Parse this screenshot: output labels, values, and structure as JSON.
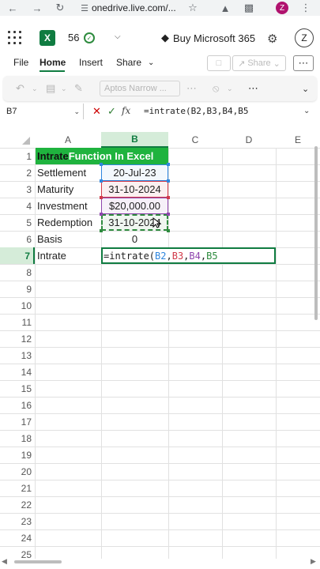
{
  "browser": {
    "url": "onedrive.live.com/...",
    "profile_initial": "Z"
  },
  "app": {
    "file_name": "56",
    "buy_label": "Buy Microsoft 365",
    "avatar_initial": "Z"
  },
  "ribbon": {
    "tabs": [
      "File",
      "Home",
      "Insert",
      "Share"
    ],
    "share_label": "Share"
  },
  "toolbar": {
    "font_name": "Aptos Narrow ..."
  },
  "formula_bar": {
    "name_box": "B7",
    "formula": "=intrate(B2,B3,B4,B5"
  },
  "grid": {
    "columns": [
      "A",
      "B",
      "C",
      "D",
      "E"
    ],
    "rows": [
      "1",
      "2",
      "3",
      "4",
      "5",
      "6",
      "7",
      "8",
      "9",
      "10",
      "11",
      "12",
      "13",
      "14",
      "15",
      "16",
      "17",
      "18",
      "19",
      "20",
      "21",
      "22",
      "23",
      "24",
      "25"
    ],
    "title_part1": "Intrate",
    "title_part2": " Function In Excel",
    "labels": [
      "Settlement",
      "Maturity",
      "Investment",
      "Redemption",
      "Basis",
      "Intrate"
    ],
    "values": [
      "20-Jul-23",
      "31-10-2024",
      "$20,000.00",
      "31-10-2024",
      "0"
    ],
    "edit": {
      "prefix": "=intrate(",
      "refs": [
        "B2",
        "B3",
        "B4",
        "B5"
      ]
    }
  },
  "colors": {
    "excel_green": "#107c41",
    "title_fill": "#1fb33e",
    "ref_B2": "#2e86de",
    "ref_B3": "#d13a4a",
    "ref_B4": "#8e44ad",
    "ref_B5": "#2e8b3e"
  }
}
